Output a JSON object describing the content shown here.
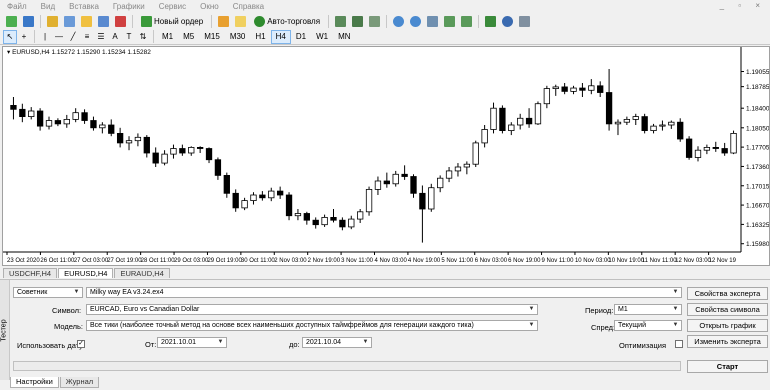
{
  "menu": {
    "items": [
      "Файл",
      "Вид",
      "Вставка",
      "Графики",
      "Сервис",
      "Окно",
      "Справка"
    ],
    "window_controls": "_ ▫ ×"
  },
  "toolbar1": {
    "new_order": "Новый ордер",
    "auto_trading": "Авто-торговля"
  },
  "toolbar2": {
    "timeframes": [
      "M1",
      "M5",
      "M15",
      "M30",
      "H1",
      "H4",
      "D1",
      "W1",
      "MN"
    ],
    "active_timeframe": "H4"
  },
  "chart": {
    "title": "EURUSD,H4  1.15272 1.15290 1.15234 1.15282"
  },
  "chart_data": {
    "type": "candlestick",
    "price_levels": [
      "1.19055",
      "1.18785",
      "1.18400",
      "1.18050",
      "1.17705",
      "1.17360",
      "1.17015",
      "1.16670",
      "1.16325",
      "1.15980"
    ],
    "time_labels": [
      "23 Oct 2020",
      "26 Oct 11:00",
      "27 Oct 03:00",
      "27 Oct 19:00",
      "28 Oct 11:00",
      "29 Oct 03:00",
      "29 Oct 19:00",
      "30 Oct 11:00",
      "2 Nov 03:00",
      "2 Nov 19:00",
      "3 Nov 11:00",
      "4 Nov 03:00",
      "4 Nov 19:00",
      "5 Nov 11:00",
      "6 Nov 03:00",
      "6 Nov 19:00",
      "9 Nov 11:00",
      "10 Nov 03:00",
      "10 Nov 19:00",
      "11 Nov 11:00",
      "12 Nov 03:00",
      "12 Nov 19"
    ],
    "ylim": [
      1.1585,
      1.1935
    ],
    "candles": [
      [
        1.1845,
        1.186,
        1.182,
        1.1838
      ],
      [
        1.1838,
        1.1848,
        1.1815,
        1.1825
      ],
      [
        1.1825,
        1.1842,
        1.182,
        1.1835
      ],
      [
        1.1835,
        1.184,
        1.18,
        1.1808
      ],
      [
        1.1808,
        1.1825,
        1.1802,
        1.1818
      ],
      [
        1.1818,
        1.1822,
        1.1808,
        1.1812
      ],
      [
        1.1812,
        1.1828,
        1.1805,
        1.182
      ],
      [
        1.182,
        1.184,
        1.1815,
        1.1832
      ],
      [
        1.1832,
        1.1838,
        1.1812,
        1.1818
      ],
      [
        1.1818,
        1.1825,
        1.18,
        1.1805
      ],
      [
        1.1805,
        1.1815,
        1.1795,
        1.181
      ],
      [
        1.181,
        1.182,
        1.179,
        1.1795
      ],
      [
        1.1795,
        1.1805,
        1.177,
        1.1778
      ],
      [
        1.1778,
        1.179,
        1.1765,
        1.1782
      ],
      [
        1.1782,
        1.1795,
        1.1772,
        1.1788
      ],
      [
        1.1788,
        1.1792,
        1.1752,
        1.176
      ],
      [
        1.176,
        1.177,
        1.1735,
        1.1742
      ],
      [
        1.1742,
        1.1765,
        1.1738,
        1.1758
      ],
      [
        1.1758,
        1.1775,
        1.175,
        1.1768
      ],
      [
        1.1768,
        1.1775,
        1.1755,
        1.176
      ],
      [
        1.176,
        1.1772,
        1.1755,
        1.177
      ],
      [
        1.177,
        1.1772,
        1.176,
        1.1768
      ],
      [
        1.1768,
        1.177,
        1.1742,
        1.1748
      ],
      [
        1.1748,
        1.1752,
        1.1712,
        1.172
      ],
      [
        1.172,
        1.1725,
        1.168,
        1.1688
      ],
      [
        1.1688,
        1.1695,
        1.1655,
        1.1662
      ],
      [
        1.1662,
        1.168,
        1.1658,
        1.1675
      ],
      [
        1.1675,
        1.169,
        1.1668,
        1.1685
      ],
      [
        1.1685,
        1.1692,
        1.1675,
        1.168
      ],
      [
        1.168,
        1.1698,
        1.1674,
        1.1692
      ],
      [
        1.1692,
        1.17,
        1.1678,
        1.1685
      ],
      [
        1.1685,
        1.169,
        1.164,
        1.1648
      ],
      [
        1.1648,
        1.166,
        1.164,
        1.1652
      ],
      [
        1.1652,
        1.1655,
        1.1632,
        1.164
      ],
      [
        1.164,
        1.1645,
        1.1625,
        1.1632
      ],
      [
        1.1632,
        1.165,
        1.1628,
        1.1645
      ],
      [
        1.1645,
        1.166,
        1.1636,
        1.164
      ],
      [
        1.164,
        1.1645,
        1.1622,
        1.1628
      ],
      [
        1.1628,
        1.1648,
        1.1624,
        1.1642
      ],
      [
        1.1642,
        1.166,
        1.1635,
        1.1655
      ],
      [
        1.1655,
        1.17,
        1.1648,
        1.1695
      ],
      [
        1.1695,
        1.1718,
        1.1685,
        1.171
      ],
      [
        1.171,
        1.1725,
        1.1698,
        1.1705
      ],
      [
        1.1705,
        1.1728,
        1.17,
        1.1722
      ],
      [
        1.1722,
        1.1738,
        1.1712,
        1.1718
      ],
      [
        1.1718,
        1.1722,
        1.168,
        1.1688
      ],
      [
        1.1688,
        1.1702,
        1.16,
        1.166
      ],
      [
        1.166,
        1.1705,
        1.1655,
        1.1698
      ],
      [
        1.1698,
        1.172,
        1.169,
        1.1715
      ],
      [
        1.1715,
        1.1735,
        1.1708,
        1.1728
      ],
      [
        1.1728,
        1.1742,
        1.1718,
        1.1735
      ],
      [
        1.1735,
        1.1745,
        1.1722,
        1.174
      ],
      [
        1.174,
        1.1782,
        1.1735,
        1.1778
      ],
      [
        1.1778,
        1.181,
        1.177,
        1.1802
      ],
      [
        1.1802,
        1.185,
        1.1795,
        1.184
      ],
      [
        1.184,
        1.1845,
        1.1795,
        1.18
      ],
      [
        1.18,
        1.1815,
        1.1792,
        1.181
      ],
      [
        1.181,
        1.183,
        1.1802,
        1.1822
      ],
      [
        1.1822,
        1.184,
        1.1805,
        1.1812
      ],
      [
        1.1812,
        1.1852,
        1.181,
        1.1848
      ],
      [
        1.1848,
        1.188,
        1.184,
        1.1875
      ],
      [
        1.1875,
        1.1882,
        1.1862,
        1.1878
      ],
      [
        1.1878,
        1.1885,
        1.1865,
        1.187
      ],
      [
        1.187,
        1.188,
        1.1865,
        1.1876
      ],
      [
        1.1876,
        1.1885,
        1.186,
        1.1872
      ],
      [
        1.1872,
        1.1892,
        1.1865,
        1.188
      ],
      [
        1.188,
        1.1888,
        1.186,
        1.1868
      ],
      [
        1.1868,
        1.191,
        1.18,
        1.1812
      ],
      [
        1.1812,
        1.182,
        1.1792,
        1.1815
      ],
      [
        1.1815,
        1.1825,
        1.181,
        1.182
      ],
      [
        1.182,
        1.183,
        1.181,
        1.1825
      ],
      [
        1.1825,
        1.183,
        1.1795,
        1.18
      ],
      [
        1.18,
        1.1812,
        1.1795,
        1.1808
      ],
      [
        1.1808,
        1.1818,
        1.18,
        1.181
      ],
      [
        1.181,
        1.1818,
        1.1803,
        1.1815
      ],
      [
        1.1815,
        1.1822,
        1.178,
        1.1785
      ],
      [
        1.1785,
        1.179,
        1.1748,
        1.1752
      ],
      [
        1.1752,
        1.1772,
        1.1745,
        1.1765
      ],
      [
        1.1765,
        1.1775,
        1.1758,
        1.177
      ],
      [
        1.177,
        1.178,
        1.1762,
        1.1768
      ],
      [
        1.1768,
        1.1778,
        1.1755,
        1.176
      ],
      [
        1.176,
        1.18,
        1.1758,
        1.1795
      ]
    ]
  },
  "chart_tabs": [
    {
      "label": "USDCHF,H4",
      "active": false
    },
    {
      "label": "EURUSD,H4",
      "active": true
    },
    {
      "label": "EURAUD,H4",
      "active": false
    }
  ],
  "tester": {
    "side_label": "Тестер",
    "mode": "Советник",
    "expert": "Milky way EA v3.24.ex4",
    "symbol_label": "Символ:",
    "symbol": "EURCAD, Euro vs Canadian Dollar",
    "model_label": "Модель:",
    "model": "Все тики (наиболее точный метод на основе всех наименьших доступных таймфреймов для генерации каждого тика)",
    "use_date_label": "Использовать дату",
    "use_date_checked": true,
    "from_label": "От:",
    "from_date": "2021.10.01",
    "to_label": "до:",
    "to_date": "2021.10.04",
    "period_label": "Период:",
    "period": "M1",
    "spread_label": "Спред:",
    "spread": "Текущий",
    "optimization_label": "Оптимизация",
    "optimization_checked": false,
    "btn_expert_props": "Свойства эксперта",
    "btn_symbol_props": "Свойства символа",
    "btn_open_chart": "Открыть график",
    "btn_modify_expert": "Изменить эксперта",
    "btn_start": "Старт"
  },
  "bottom_tabs": [
    {
      "label": "Настройки",
      "active": true
    },
    {
      "label": "Журнал",
      "active": false
    }
  ]
}
